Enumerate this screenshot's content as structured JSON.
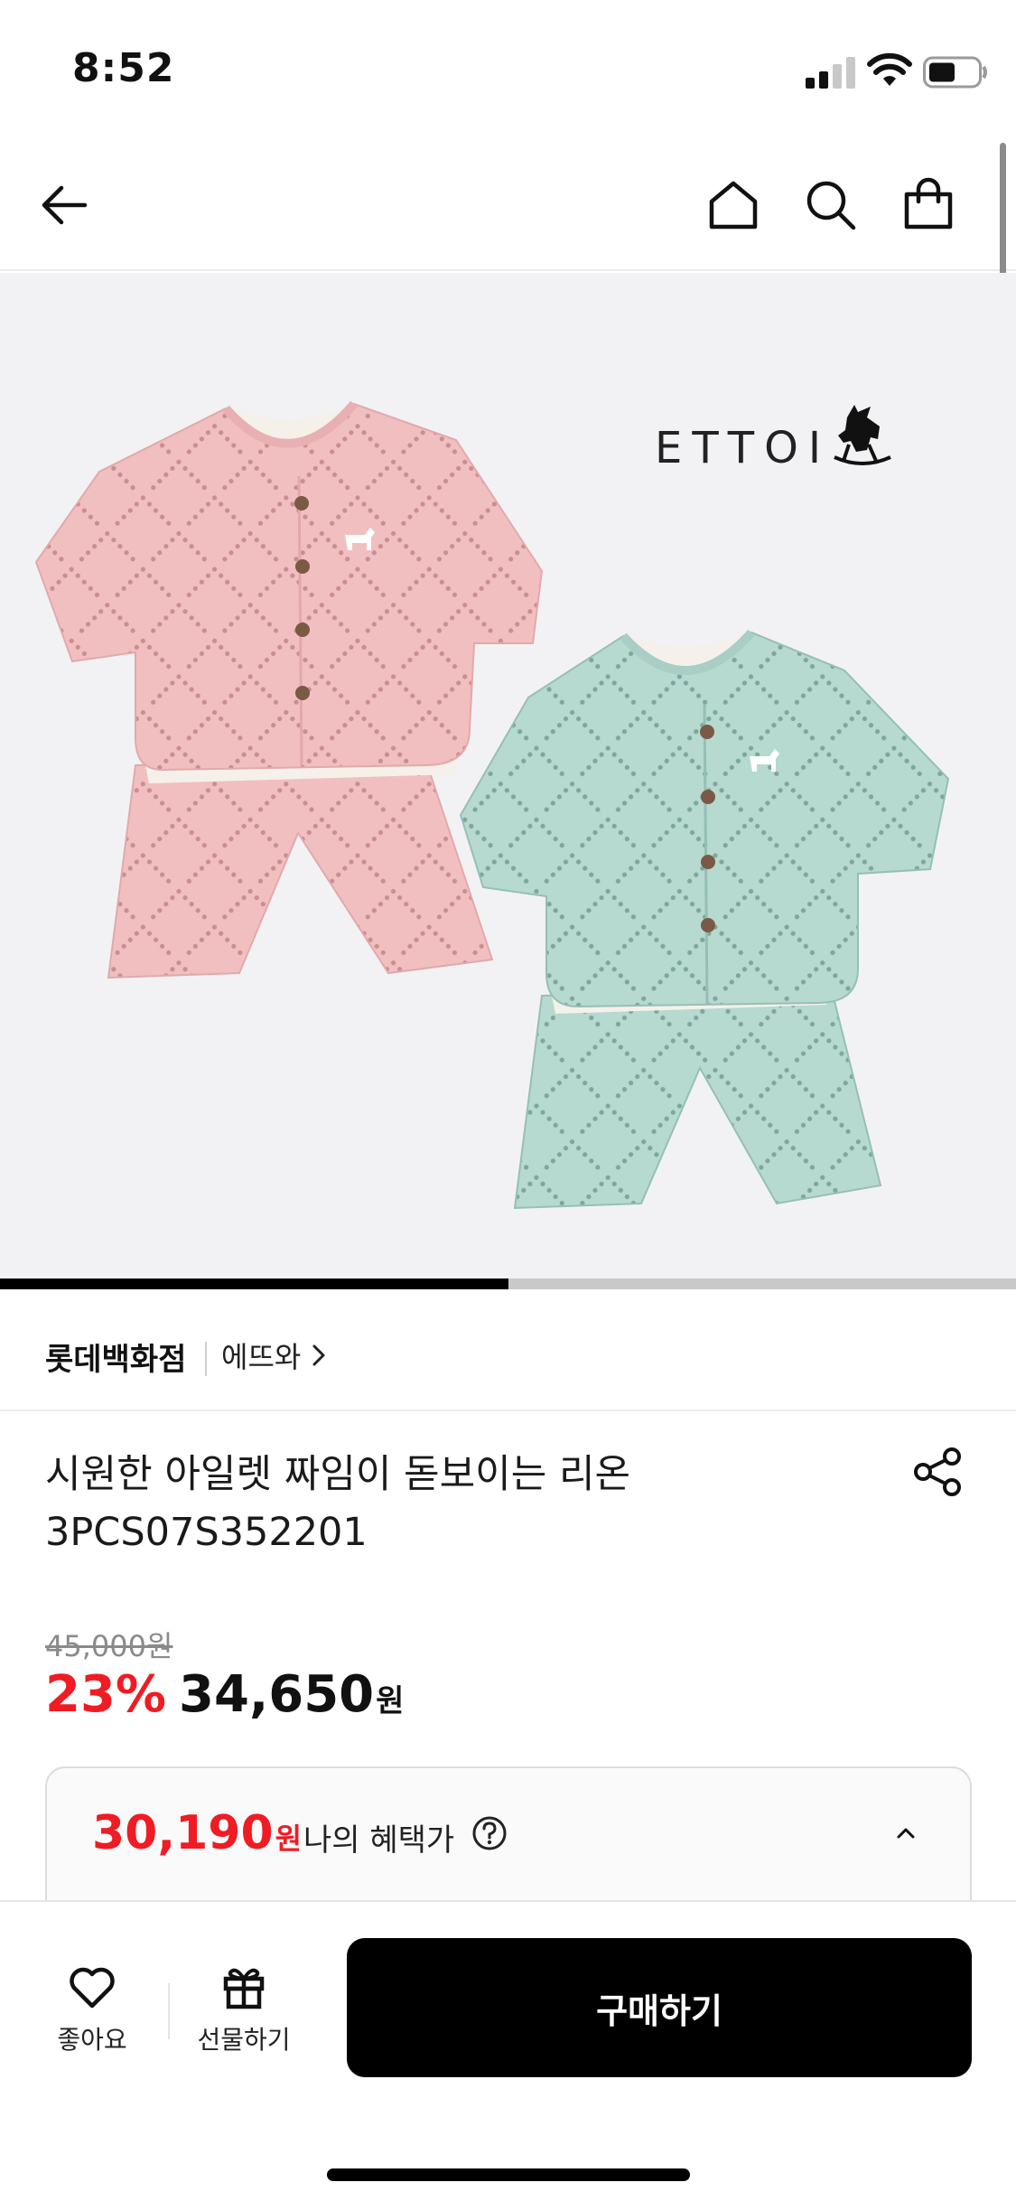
{
  "status_bar": {
    "time": "8:52"
  },
  "nav": {
    "icons": [
      "back-arrow-icon",
      "home-icon",
      "search-icon",
      "shopping-bag-icon"
    ]
  },
  "product_image": {
    "brand_logo_text": "ETTOI",
    "image_index_fraction": 0.5,
    "colors": {
      "pink": "#f2bfc0",
      "mint": "#b6d9d0",
      "background": "#f2f2f4"
    }
  },
  "brand_row": {
    "seller": "롯데백화점",
    "brand": "에뜨와"
  },
  "product": {
    "title_line1": "시원한 아일렛 짜임이 돋보이는 리온",
    "title_line2": "3PCS07S352201"
  },
  "price": {
    "original": "45,000원",
    "discount_rate": "23%",
    "sale_price": "34,650",
    "sale_unit": "원"
  },
  "benefit": {
    "amount": "30,190",
    "unit": "원",
    "label": "나의 혜택가"
  },
  "bottom_bar": {
    "like_label": "좋아요",
    "gift_label": "선물하기",
    "buy_label": "구매하기"
  },
  "colors": {
    "accent_red": "#ef1c24",
    "buy_button": "#000000"
  }
}
